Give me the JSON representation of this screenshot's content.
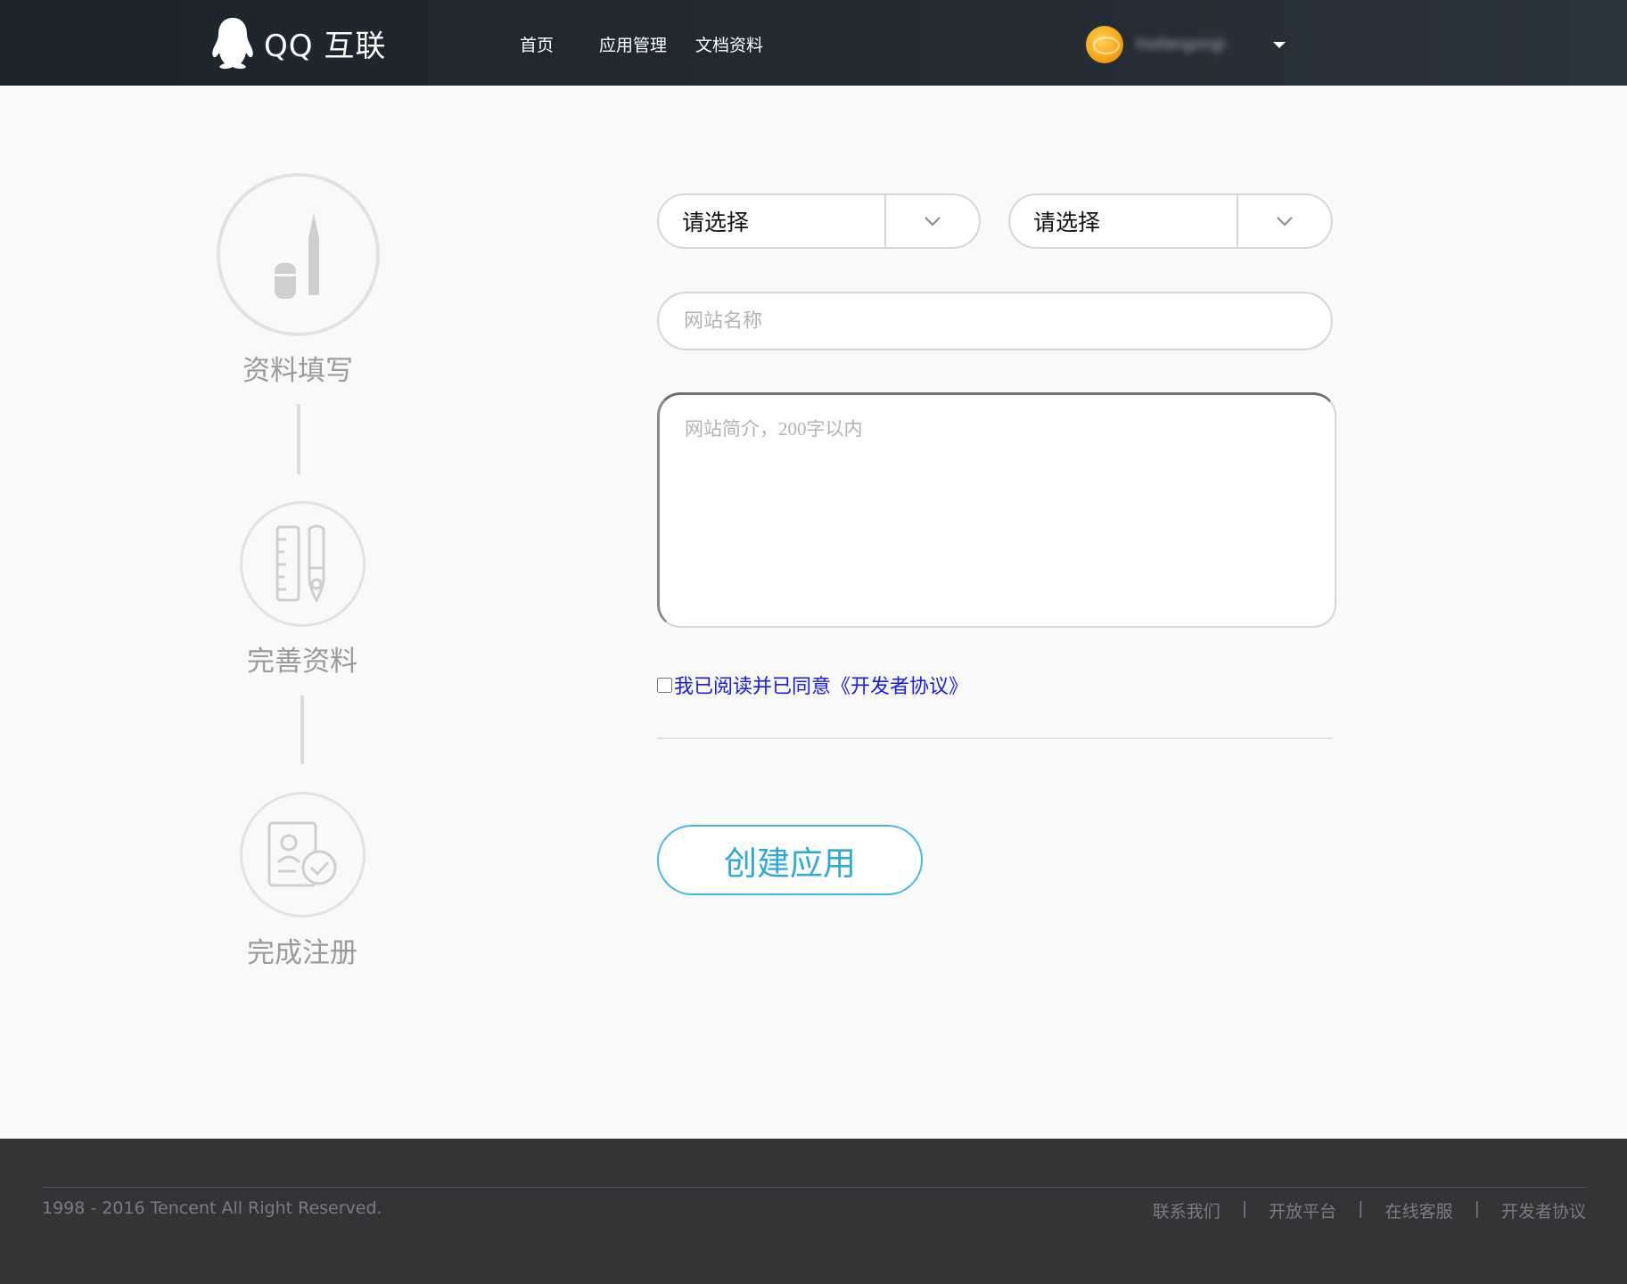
{
  "header": {
    "logo_text": "QQ 互联",
    "nav": [
      "首页",
      "应用管理",
      "文档资料"
    ],
    "username": "hiofangongi"
  },
  "steps": [
    "资料填写",
    "完善资料",
    "完成注册"
  ],
  "form": {
    "select1": "请选择",
    "select2": "请选择",
    "name_placeholder": "网站名称",
    "intro_placeholder": "网站简介，200字以内",
    "agree_text": "我已阅读并已同意《开发者协议》",
    "submit_label": "创建应用"
  },
  "footer": {
    "copyright": "1998 - 2016 Tencent All Right Reserved.",
    "links": [
      "联系我们",
      "开放平台",
      "在线客服",
      "开发者协议"
    ],
    "separator": "|"
  },
  "colors": {
    "accent": "#41b9e3",
    "link": "#1a1ae8",
    "header_bg": "#1d232a",
    "footer_bg": "#333436"
  }
}
